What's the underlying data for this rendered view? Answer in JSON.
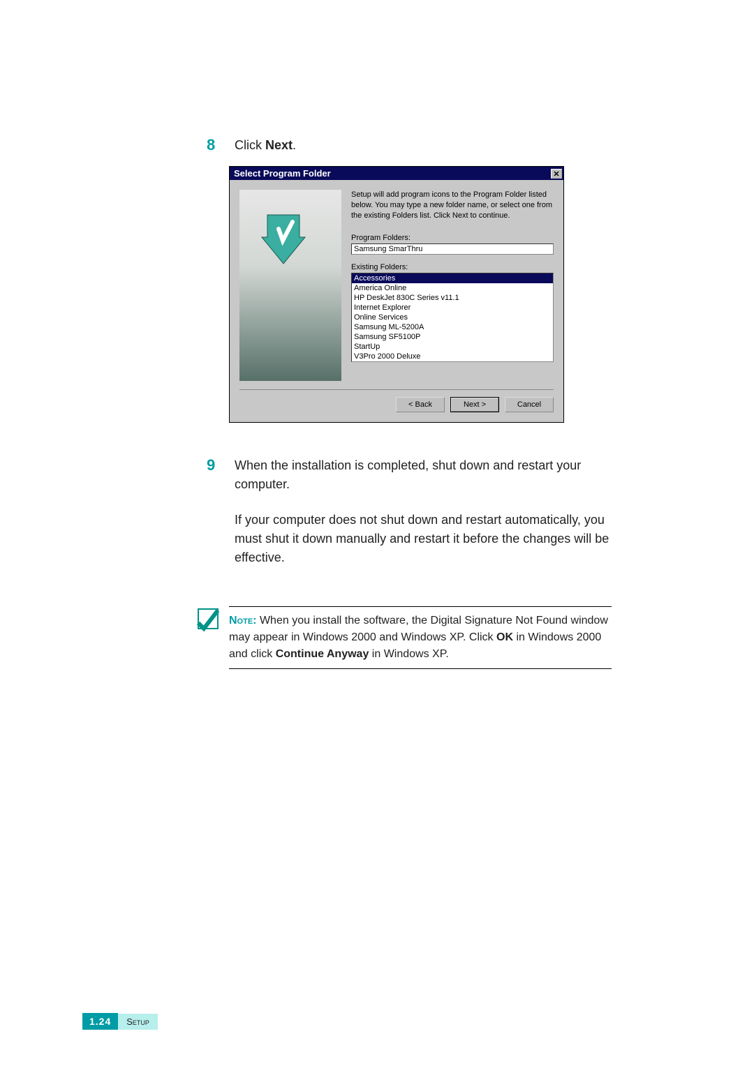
{
  "step8": {
    "number": "8",
    "textPrefix": "Click ",
    "textBold": "Next",
    "textSuffix": "."
  },
  "dialog": {
    "title": "Select Program Folder",
    "description": "Setup will add program icons to the Program Folder listed below. You may type a new folder name, or select one from the existing Folders list.  Click Next to continue.",
    "programLabel": "Program Folders:",
    "programValue": "Samsung SmarThru",
    "existingLabel": "Existing Folders:",
    "folders": [
      "Accessories",
      "America Online",
      "HP DeskJet 830C Series v11.1",
      "Internet Explorer",
      "Online Services",
      "Samsung ML-5200A",
      "Samsung SF5100P",
      "StartUp",
      "V3Pro 2000 Deluxe"
    ],
    "buttons": {
      "back": "< Back",
      "next": "Next >",
      "cancel": "Cancel"
    }
  },
  "step9": {
    "number": "9",
    "p1": "When the installation is completed, shut down and restart your computer.",
    "p2": "If your computer does not shut down and restart automatically, you must shut it down manually and restart it before the changes will be effective."
  },
  "note": {
    "label": "Note:",
    "part1": " When you install the software, the Digital Signature Not Found window may appear in Windows 2000 and Windows XP. Click ",
    "b1": "OK",
    "part2": " in Windows 2000 and click ",
    "b2": "Continue Anyway",
    "part3": " in Windows XP."
  },
  "footer": {
    "page": "1.24",
    "section": "Setup"
  }
}
